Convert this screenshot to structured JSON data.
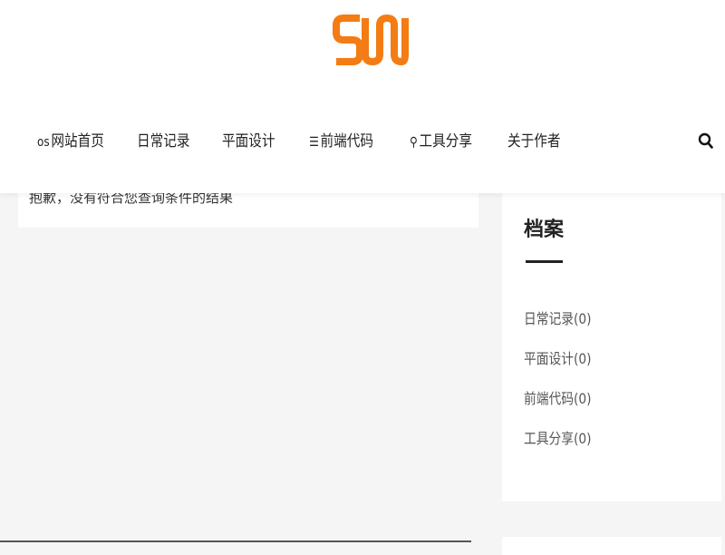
{
  "brand": {
    "logo_text": "SW",
    "accent_color": "#f47c14"
  },
  "nav": {
    "items": [
      {
        "label": "网站首页",
        "icon": "os",
        "icon_name": "home-os-icon"
      },
      {
        "label": "日常记录",
        "icon": "",
        "icon_name": ""
      },
      {
        "label": "平面设计",
        "icon": "",
        "icon_name": ""
      },
      {
        "label": "前端代码",
        "icon": "☰",
        "icon_name": "list-icon"
      },
      {
        "label": "工具分享",
        "icon": "⚲",
        "icon_name": "tool-icon"
      },
      {
        "label": "关于作者",
        "icon": "",
        "icon_name": ""
      }
    ],
    "search_icon": "search-icon"
  },
  "main": {
    "empty_message": "抱歉，没有符合您查询条件的结果"
  },
  "sidebar": {
    "title": "档案",
    "archives": [
      {
        "label": "日常记录(0)"
      },
      {
        "label": "平面设计(0)"
      },
      {
        "label": "前端代码(0)"
      },
      {
        "label": "工具分享(0)"
      }
    ]
  }
}
